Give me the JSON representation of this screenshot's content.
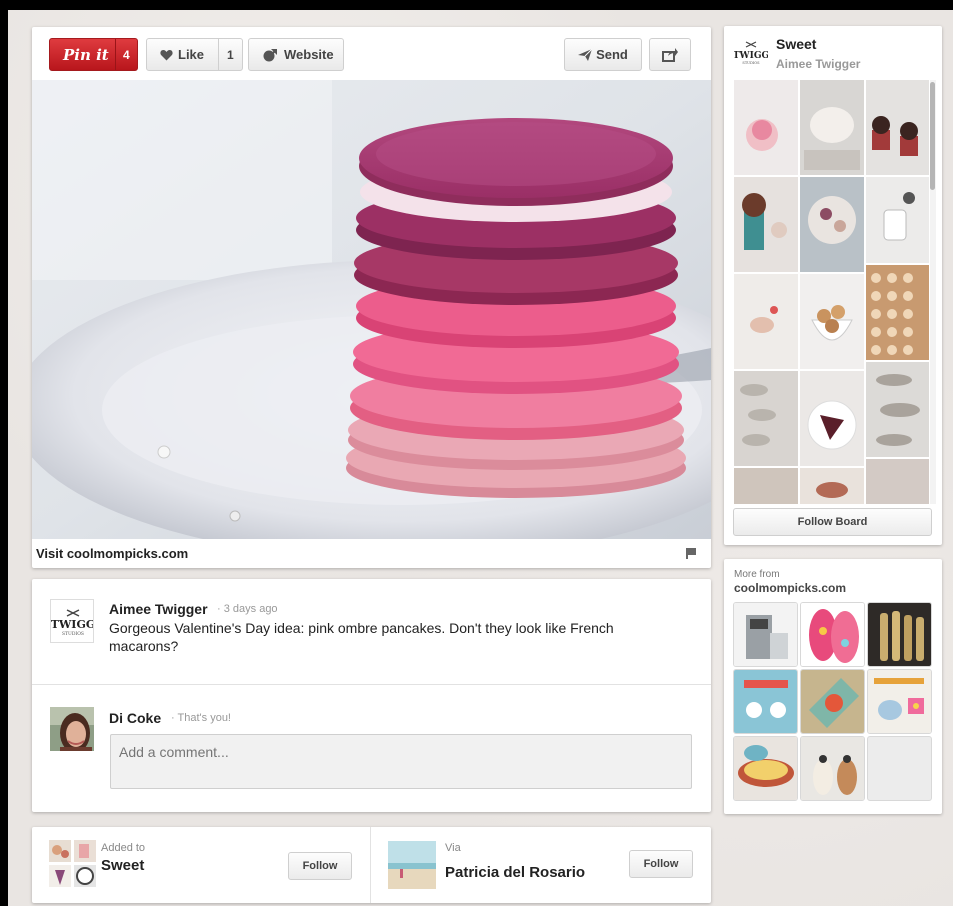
{
  "toolbar": {
    "pin_it_label": "Pin it",
    "pin_count": "4",
    "like_label": "Like",
    "like_count": "1",
    "website_label": "Website",
    "send_label": "Send"
  },
  "pin": {
    "visit_link": "Visit coolmompicks.com"
  },
  "description": {
    "author": "Aimee Twigger",
    "time": "3 days ago",
    "text": "Gorgeous Valentine's Day idea: pink ombre pancakes. Don't they look like French macarons?"
  },
  "comment": {
    "user_name": "Di Coke",
    "user_note": "That's you!",
    "placeholder": "Add a comment..."
  },
  "added_to": {
    "label": "Added to",
    "board": "Sweet",
    "follow_label": "Follow"
  },
  "via": {
    "label": "Via",
    "name": "Patricia del Rosario",
    "follow_label": "Follow"
  },
  "board": {
    "logo_text": "TWIGG",
    "logo_sub": "STUDIOS",
    "name": "Sweet",
    "owner": "Aimee Twigger",
    "follow_label": "Follow Board"
  },
  "more_from": {
    "label": "More from",
    "source": "coolmompicks.com"
  },
  "colors": {
    "pin_red": "#cb2027",
    "page_bg": "#e9e5e2",
    "card_bg": "#ffffff"
  }
}
